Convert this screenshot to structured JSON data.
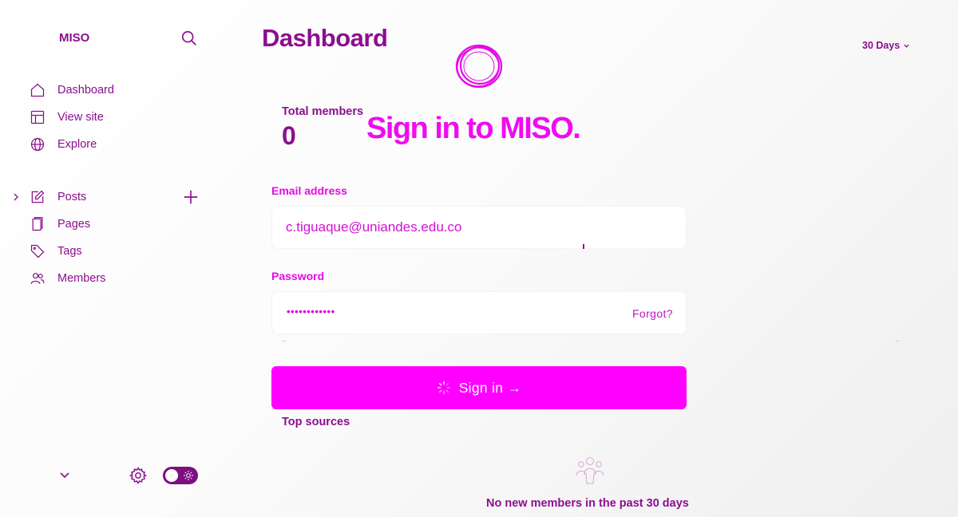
{
  "sidebar": {
    "brand": "MISO",
    "items": [
      {
        "label": "Dashboard",
        "icon": "home-icon"
      },
      {
        "label": "View site",
        "icon": "layout-icon"
      },
      {
        "label": "Explore",
        "icon": "globe-icon"
      },
      {
        "label": "Posts",
        "icon": "pencil-icon"
      },
      {
        "label": "Pages",
        "icon": "page-icon"
      },
      {
        "label": "Tags",
        "icon": "tag-icon"
      },
      {
        "label": "Members",
        "icon": "members-icon"
      }
    ],
    "theme_toggle": {
      "state": "dark-mode-off",
      "icon": "sun-icon"
    }
  },
  "header": {
    "title": "Dashboard",
    "range": "30 Days"
  },
  "dashboard": {
    "total_members_label": "Total members",
    "total_members_value": "0",
    "top_sources_label": "Top sources",
    "empty_state": "No new members in the past 30 days"
  },
  "signin": {
    "title": "Sign in to MISO.",
    "email_label": "Email address",
    "email_value": "c.tiguaque@uniandes.edu.co",
    "password_label": "Password",
    "password_value": "••••••••••••",
    "forgot_label": "Forgot?",
    "button_label": "Sign in →"
  },
  "colors": {
    "accent": "#ff00ff",
    "dashboard_text": "#8b0f8e",
    "signin_text": "#e60ae6",
    "background": "#f7f7f7"
  }
}
